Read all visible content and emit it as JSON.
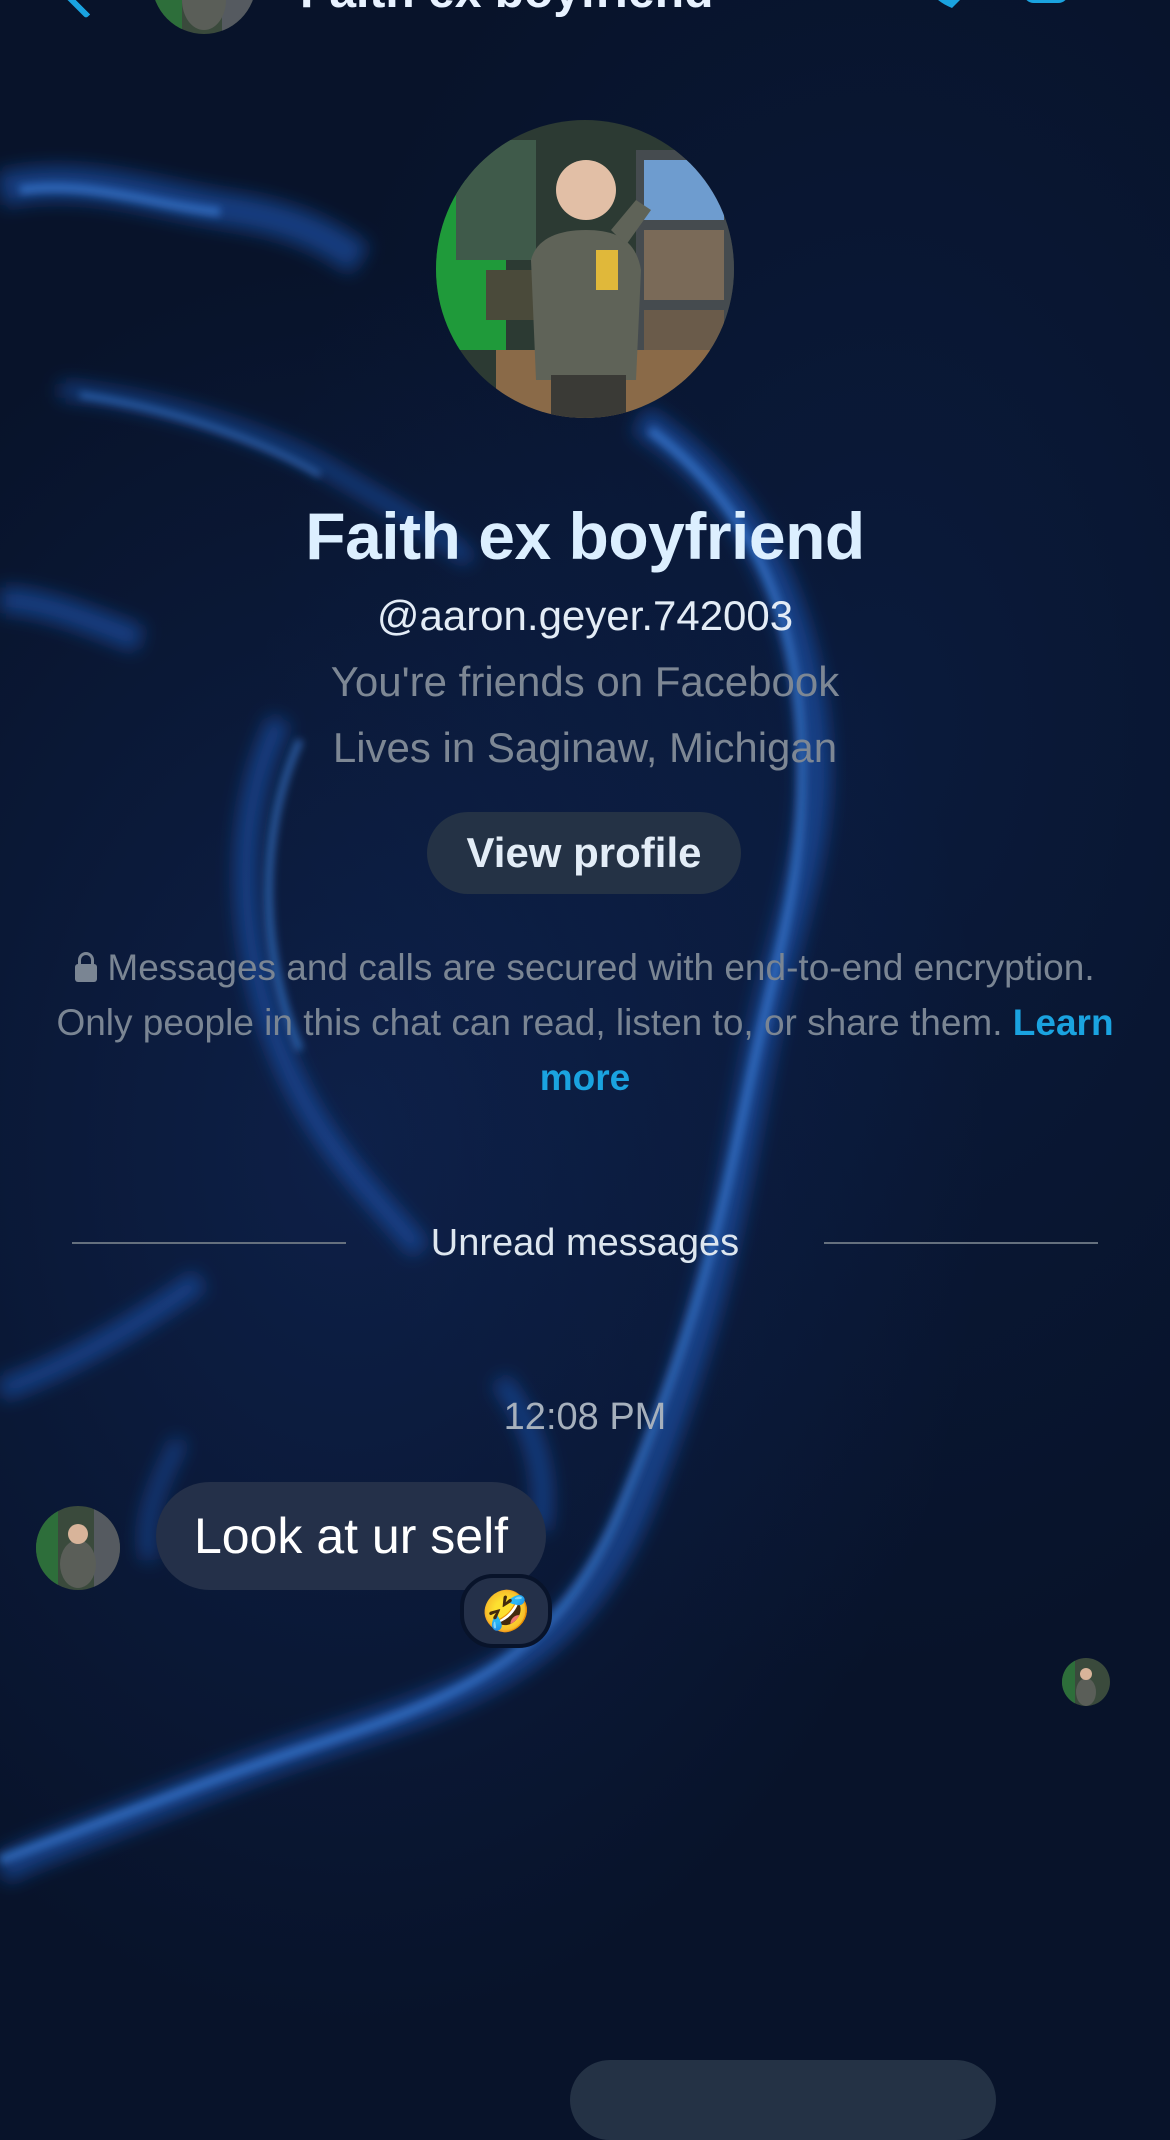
{
  "header": {
    "name": "Faith ex boyfriend"
  },
  "profile": {
    "name": "Faith ex boyfriend",
    "username": "@aaron.geyer.742003",
    "friends_status": "You're friends on Facebook",
    "location": "Lives in Saginaw, Michigan",
    "view_profile_label": "View profile"
  },
  "encryption": {
    "text": "Messages and calls are secured with end-to-end encryption. Only people in this chat can read, listen to, or share them. ",
    "learn_more": "Learn more"
  },
  "divider": {
    "label": "Unread messages"
  },
  "conversation": {
    "timestamp": "12:08 PM",
    "messages": [
      {
        "text": "Look at ur self",
        "reaction": "🤣"
      }
    ]
  },
  "colors": {
    "accent": "#1aa3e0",
    "background": "#08132a",
    "bubble": "#243049",
    "button": "#243245"
  }
}
